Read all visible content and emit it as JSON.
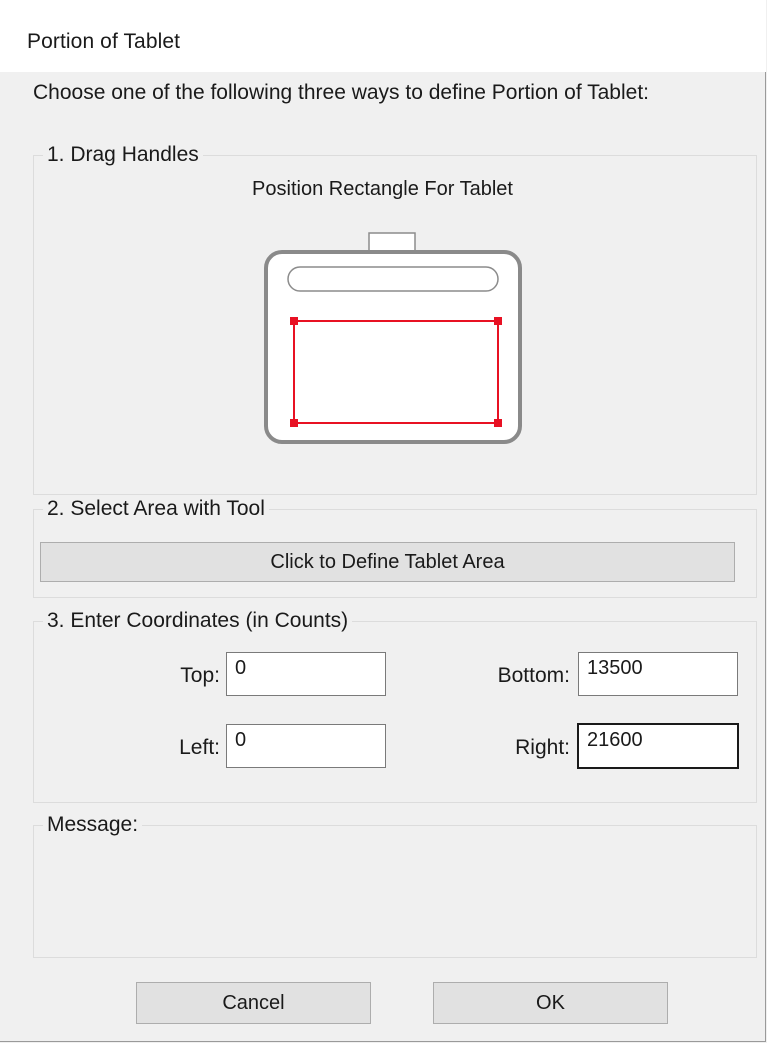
{
  "window": {
    "title": "Portion of Tablet"
  },
  "instructions": "Choose one of the following three ways to define Portion of Tablet:",
  "drag_handles": {
    "legend": "1. Drag Handles",
    "caption": "Position Rectangle For Tablet"
  },
  "select_area": {
    "legend": "2. Select Area with Tool",
    "button_label": "Click to Define Tablet Area"
  },
  "coordinates": {
    "legend": "3. Enter Coordinates (in Counts)",
    "top_label": "Top:",
    "top_value": "0",
    "bottom_label": "Bottom:",
    "bottom_value": "13500",
    "left_label": "Left:",
    "left_value": "0",
    "right_label": "Right:",
    "right_value": "21600"
  },
  "message": {
    "legend": "Message:",
    "text": ""
  },
  "buttons": {
    "cancel": "Cancel",
    "ok": "OK"
  },
  "colors": {
    "handle": "#e81123",
    "window_bg": "#f0f0f0",
    "titlebar_bg": "#ffffff"
  }
}
